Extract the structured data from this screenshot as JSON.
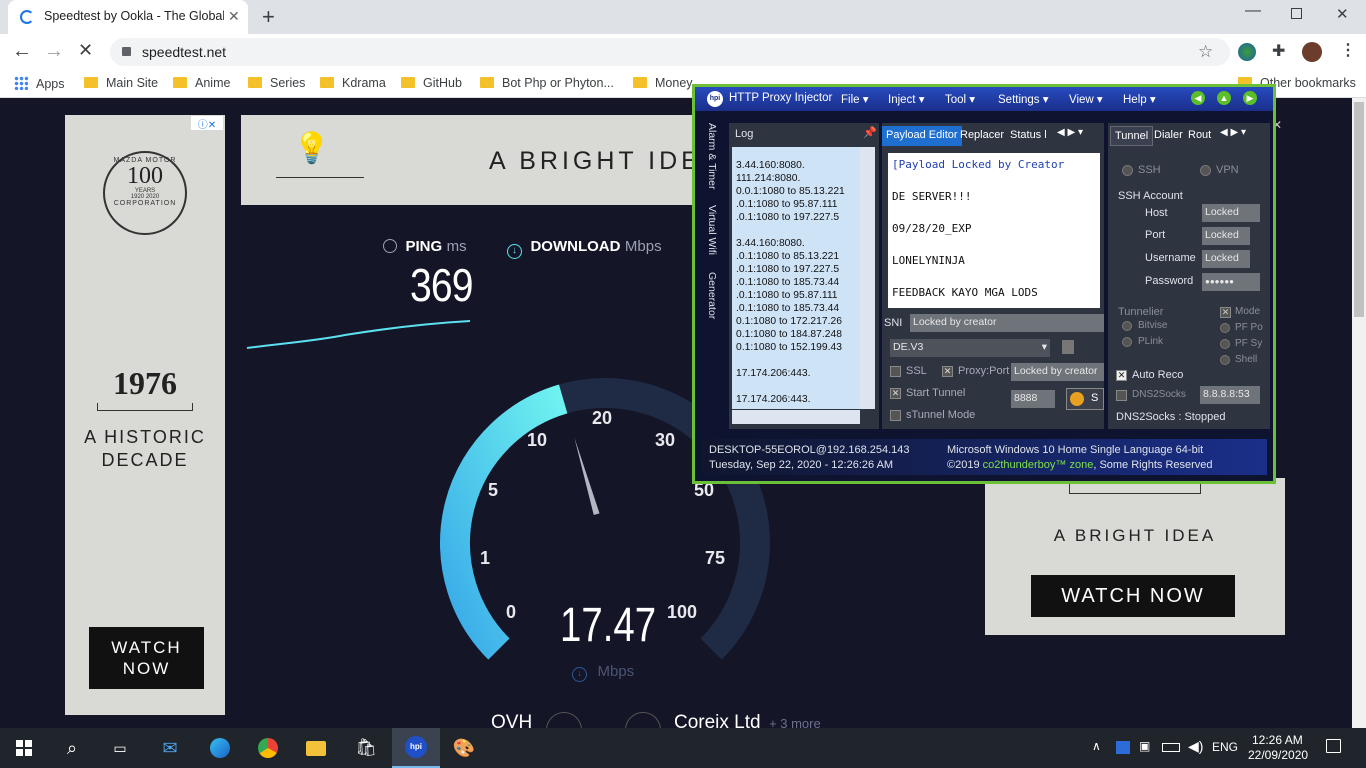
{
  "browser": {
    "tab_title": "Speedtest by Ookla - The Global Broadband Speed Test",
    "url": "speedtest.net",
    "bookmarks": [
      {
        "label": "Apps"
      },
      {
        "label": "Main Site"
      },
      {
        "label": "Anime"
      },
      {
        "label": "Series"
      },
      {
        "label": "Kdrama"
      },
      {
        "label": "GitHub"
      },
      {
        "label": "Bot Php or Phyton..."
      },
      {
        "label": "Money"
      },
      {
        "label": "Other bookmarks"
      }
    ]
  },
  "speedtest": {
    "ping_label": "PING",
    "ping_unit": "ms",
    "ping_value": "369",
    "download_label": "DOWNLOAD",
    "download_unit": "Mbps",
    "speed_value": "17.47",
    "speed_unit": "Mbps",
    "gauge_ticks": [
      "0",
      "1",
      "5",
      "10",
      "20",
      "30",
      "50",
      "75",
      "100"
    ],
    "gauge_fraction": 0.44,
    "server": "OVH",
    "provider": "Coreix Ltd",
    "more": "+ 3 more"
  },
  "ads": {
    "top_banner": "A BRIGHT IDEA",
    "left_brand_lines": [
      "MAZDA MOTOR",
      "100",
      "YEARS",
      "1920",
      "2020",
      "CORPORATION"
    ],
    "left_year": "1976",
    "left_line1": "A HISTORIC",
    "left_line2": "DECADE",
    "left_button": "WATCH NOW",
    "right_title": "A BRIGHT IDEA",
    "right_button": "WATCH NOW"
  },
  "hpi": {
    "title": "HTTP Proxy Injector",
    "menus": [
      "File",
      "Inject",
      "Tool",
      "Settings",
      "View",
      "Help"
    ],
    "side_tabs": [
      "Alarm & Timer",
      "Virtual Wifi",
      "Generator"
    ],
    "log_title": "Log",
    "log_lines": [
      "3.44.160:8080.",
      "111.214:8080.",
      "0.0.1:1080 to 85.13.221",
      ".0.1:1080 to 95.87.111",
      ".0.1:1080 to 197.227.5",
      "",
      "3.44.160:8080.",
      ".0.1:1080 to 85.13.221",
      ".0.1:1080 to 197.227.5",
      ".0.1:1080 to 185.73.44",
      ".0.1:1080 to 95.87.111",
      ".0.1:1080 to 185.73.44",
      "0.1:1080 to 172.217.26",
      "0.1:1080 to 184.87.248",
      "0.1:1080 to 152.199.43",
      "",
      "17.174.206:443.",
      "",
      "17.174.206:443."
    ],
    "tabs_mid": [
      "Payload Editor",
      "Replacer",
      "Status l"
    ],
    "payload_lines": [
      "[Payload Locked by Creator",
      "",
      "DE SERVER!!!",
      "",
      "09/28/20_EXP",
      "",
      "LONELYNINJA",
      "",
      "FEEDBACK KAYO MGA LODS"
    ],
    "sni_label": "SNI",
    "sni_value": "Locked by creator",
    "server_select": "DE.V3",
    "ssl_label": "SSL",
    "proxy_label": "Proxy:Port",
    "proxy_value": "Locked by creator",
    "start_tunnel": "Start Tunnel",
    "port_value": "8888",
    "stunnel": "sTunnel Mode",
    "stop_btn": "S",
    "tabs_right": [
      "Tunnel",
      "Dialer",
      "Rout"
    ],
    "ssh": "SSH",
    "vpn": "VPN",
    "ssh_account": "SSH Account",
    "fields": [
      {
        "label": "Host",
        "value": "Locked"
      },
      {
        "label": "Port",
        "value": "Locked"
      },
      {
        "label": "Username",
        "value": "Locked"
      },
      {
        "label": "Password",
        "value": "●●●●●●"
      }
    ],
    "tunnelier": "Tunnelier",
    "bitvise": "Bitvise",
    "plink": "PLink",
    "mode": "Mode",
    "pf1": "PF Po",
    "pf2": "PF Sy",
    "shell": "Shell",
    "auto_reco": "Auto Reco",
    "dns2socks": "DNS2Socks",
    "dns_value": "8.8.8.8:53",
    "dns_status": "DNS2Socks : Stopped",
    "status_left1": "DESKTOP-55EOROL@192.168.254.143",
    "status_left2": "Tuesday, Sep 22, 2020 - 12:26:26 AM",
    "status_right1": "Microsoft Windows 10 Home Single Language 64-bit",
    "status_right2a": "©2019",
    "status_right2b": "co2thunderboy™ zone",
    "status_right2c": ", Some Rights Reserved"
  },
  "taskbar": {
    "lang": "ENG",
    "time": "12:26 AM",
    "date": "22/09/2020"
  },
  "colors": {
    "accent": "#5ce1f0",
    "page_bg": "#141526",
    "hpi_border": "#6cc038",
    "hpi_menu": "#274bbf",
    "link": "#7ee04a"
  }
}
